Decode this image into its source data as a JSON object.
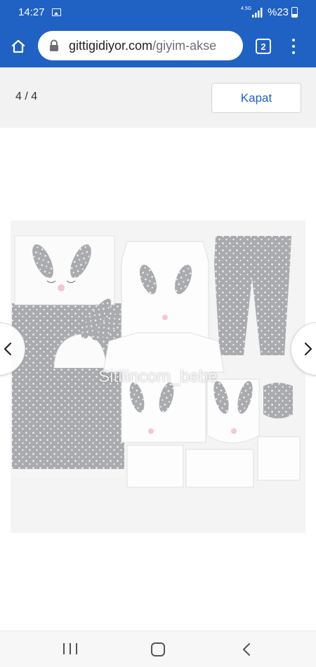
{
  "status_bar": {
    "time": "14:27",
    "network": "4.5G",
    "battery": "%23",
    "icons": [
      "gallery-icon",
      "signal-icon",
      "battery-icon"
    ]
  },
  "browser": {
    "url_domain": "gittigidiyor.com",
    "url_path": "/giyim-akse",
    "tab_count": "2",
    "accent_color": "#1f62c4",
    "icons": [
      "home-icon",
      "lock-icon",
      "tabs-icon",
      "more-vert-icon"
    ]
  },
  "viewer": {
    "counter": "4 / 4",
    "close_label": "Kapat",
    "watermark": "Sitilincom_bebe",
    "icons": [
      "chevron-left-icon",
      "chevron-right-icon"
    ]
  },
  "system_nav": {
    "icons": [
      "recents-icon",
      "home-icon",
      "back-icon"
    ]
  }
}
